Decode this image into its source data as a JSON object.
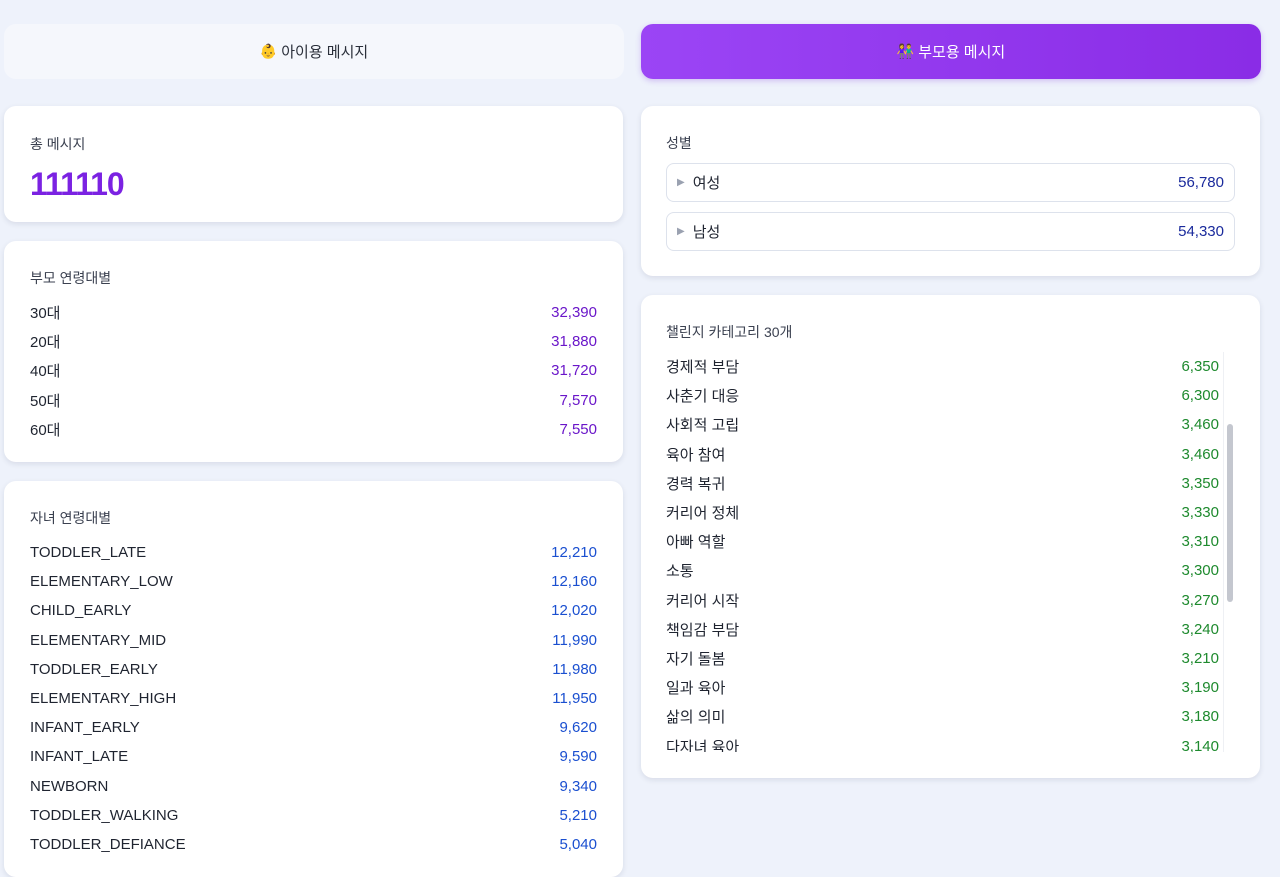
{
  "tabs": {
    "child": {
      "icon": "👶",
      "label": "아이용 메시지"
    },
    "parent": {
      "icon": "👫",
      "label": "부모용 메시지"
    }
  },
  "total": {
    "title": "총 메시지",
    "value": "111110"
  },
  "parent_age": {
    "title": "부모 연령대별",
    "items": [
      {
        "label": "30대",
        "value": "32,390"
      },
      {
        "label": "20대",
        "value": "31,880"
      },
      {
        "label": "40대",
        "value": "31,720"
      },
      {
        "label": "50대",
        "value": "7,570"
      },
      {
        "label": "60대",
        "value": "7,550"
      }
    ]
  },
  "child_age": {
    "title": "자녀 연령대별",
    "items": [
      {
        "label": "TODDLER_LATE",
        "value": "12,210"
      },
      {
        "label": "ELEMENTARY_LOW",
        "value": "12,160"
      },
      {
        "label": "CHILD_EARLY",
        "value": "12,020"
      },
      {
        "label": "ELEMENTARY_MID",
        "value": "11,990"
      },
      {
        "label": "TODDLER_EARLY",
        "value": "11,980"
      },
      {
        "label": "ELEMENTARY_HIGH",
        "value": "11,950"
      },
      {
        "label": "INFANT_EARLY",
        "value": "9,620"
      },
      {
        "label": "INFANT_LATE",
        "value": "9,590"
      },
      {
        "label": "NEWBORN",
        "value": "9,340"
      },
      {
        "label": "TODDLER_WALKING",
        "value": "5,210"
      },
      {
        "label": "TODDLER_DEFIANCE",
        "value": "5,040"
      }
    ]
  },
  "gender": {
    "title": "성별",
    "items": [
      {
        "label": "여성",
        "value": "56,780"
      },
      {
        "label": "남성",
        "value": "54,330"
      }
    ]
  },
  "challenge": {
    "title": "챌린지 카테고리 30개",
    "items": [
      {
        "label": "경제적 부담",
        "value": "6,350"
      },
      {
        "label": "사춘기 대응",
        "value": "6,300"
      },
      {
        "label": "사회적 고립",
        "value": "3,460"
      },
      {
        "label": "육아 참여",
        "value": "3,460"
      },
      {
        "label": "경력 복귀",
        "value": "3,350"
      },
      {
        "label": "커리어 정체",
        "value": "3,330"
      },
      {
        "label": "아빠 역할",
        "value": "3,310"
      },
      {
        "label": "소통",
        "value": "3,300"
      },
      {
        "label": "커리어 시작",
        "value": "3,270"
      },
      {
        "label": "책임감 부담",
        "value": "3,240"
      },
      {
        "label": "자기 돌봄",
        "value": "3,210"
      },
      {
        "label": "일과 육아",
        "value": "3,190"
      },
      {
        "label": "삶의 의미",
        "value": "3,180"
      },
      {
        "label": "다자녀 육아",
        "value": "3,140"
      }
    ]
  },
  "colors": {
    "accent_purple": "#8a2ce6",
    "parent_age_value": "#6a16c9",
    "child_age_value": "#1a4fd0",
    "gender_value": "#1a2a9c",
    "challenge_value": "#1e8a2e"
  }
}
